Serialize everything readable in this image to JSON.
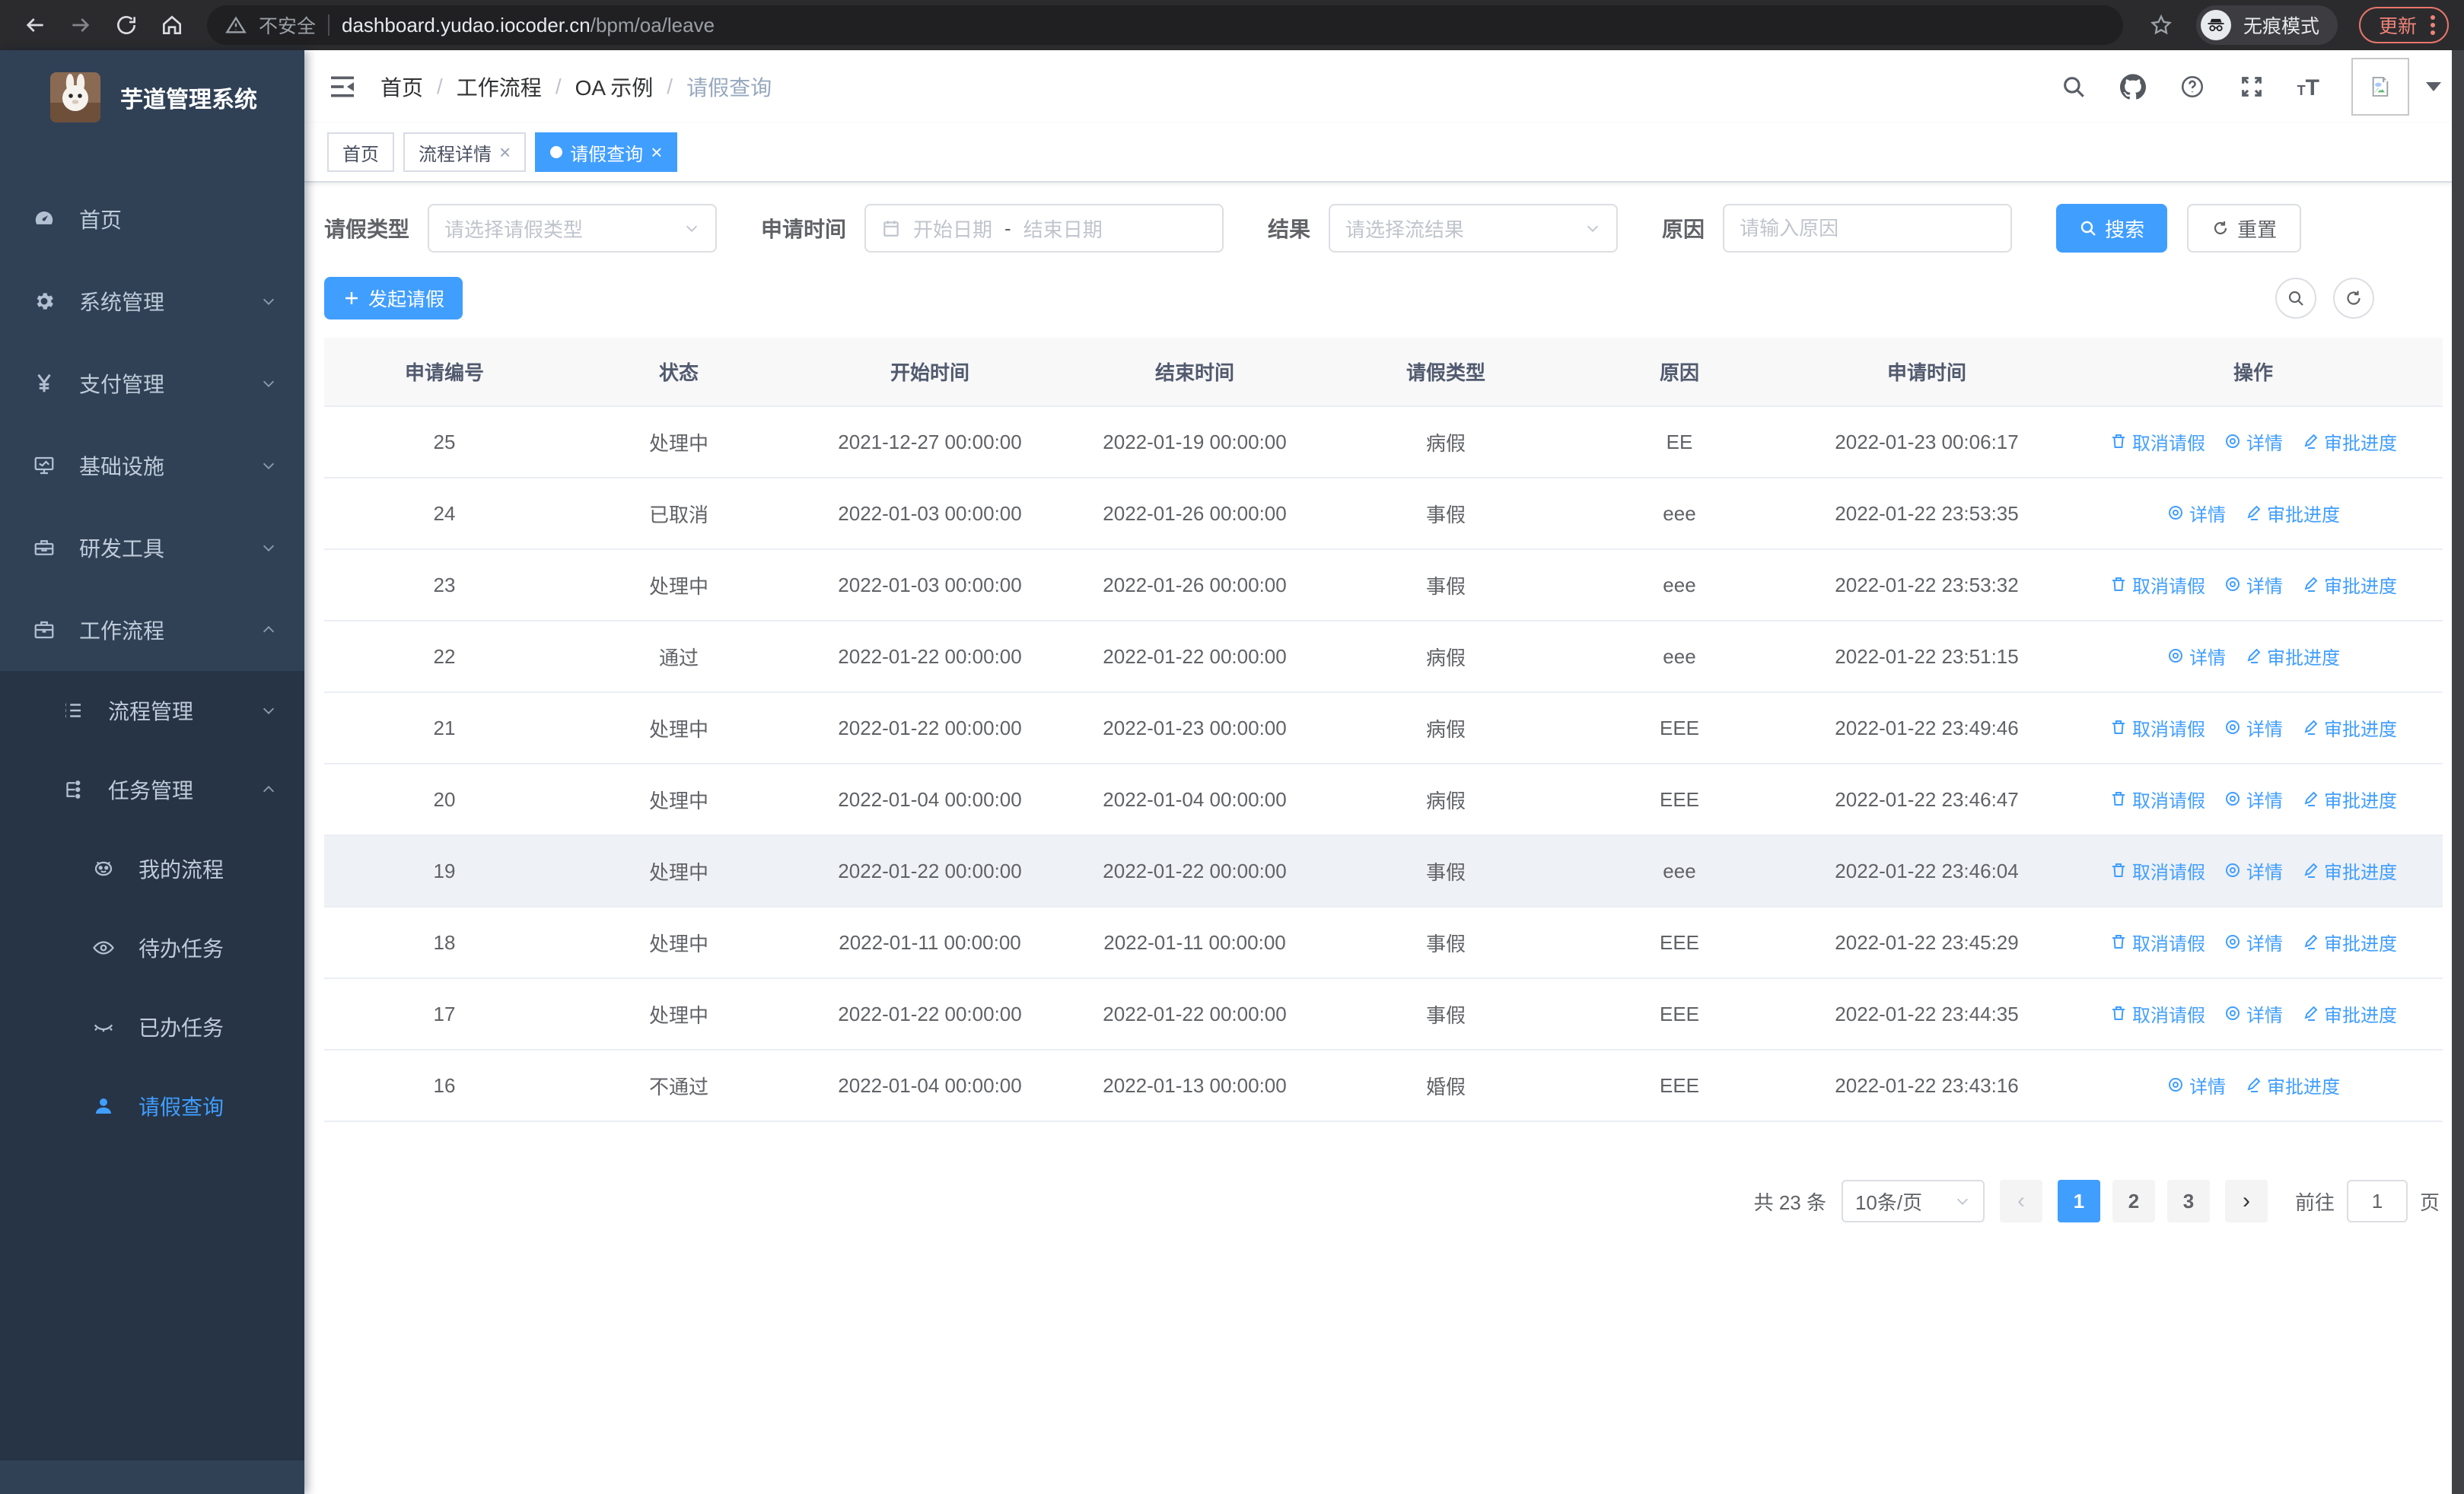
{
  "browser": {
    "security_label": "不安全",
    "url_host": "dashboard.yudao.iocoder.cn",
    "url_path": "/bpm/oa/leave",
    "incognito_label": "无痕模式",
    "update_label": "更新"
  },
  "sidebar": {
    "title": "芋道管理系统",
    "items": [
      {
        "label": "首页"
      },
      {
        "label": "系统管理"
      },
      {
        "label": "支付管理"
      },
      {
        "label": "基础设施"
      },
      {
        "label": "研发工具"
      },
      {
        "label": "工作流程"
      }
    ],
    "submenu": [
      {
        "label": "流程管理"
      },
      {
        "label": "任务管理"
      }
    ],
    "tasks": [
      {
        "label": "我的流程"
      },
      {
        "label": "待办任务"
      },
      {
        "label": "已办任务"
      },
      {
        "label": "请假查询"
      }
    ]
  },
  "header": {
    "breadcrumb": [
      "首页",
      "工作流程",
      "OA 示例",
      "请假查询"
    ]
  },
  "tabs": [
    {
      "label": "首页"
    },
    {
      "label": "流程详情"
    },
    {
      "label": "请假查询"
    }
  ],
  "filters": {
    "leave_type_label": "请假类型",
    "leave_type_placeholder": "请选择请假类型",
    "apply_time_label": "申请时间",
    "date_start_placeholder": "开始日期",
    "date_separator": "-",
    "date_end_placeholder": "结束日期",
    "result_label": "结果",
    "result_placeholder": "请选择流结果",
    "reason_label": "原因",
    "reason_placeholder": "请输入原因",
    "search_label": "搜索",
    "reset_label": "重置"
  },
  "toolbar": {
    "create_label": "发起请假"
  },
  "table": {
    "headers": [
      "申请编号",
      "状态",
      "开始时间",
      "结束时间",
      "请假类型",
      "原因",
      "申请时间",
      "操作"
    ],
    "action_labels": {
      "cancel": "取消请假",
      "detail": "详情",
      "progress": "审批进度"
    },
    "rows": [
      {
        "id": "25",
        "status": "处理中",
        "start": "2021-12-27 00:00:00",
        "end": "2022-01-19 00:00:00",
        "type": "病假",
        "reason": "EE",
        "applied": "2022-01-23 00:06:17",
        "actions": [
          "cancel",
          "detail",
          "progress"
        ]
      },
      {
        "id": "24",
        "status": "已取消",
        "start": "2022-01-03 00:00:00",
        "end": "2022-01-26 00:00:00",
        "type": "事假",
        "reason": "eee",
        "applied": "2022-01-22 23:53:35",
        "actions": [
          "detail",
          "progress"
        ]
      },
      {
        "id": "23",
        "status": "处理中",
        "start": "2022-01-03 00:00:00",
        "end": "2022-01-26 00:00:00",
        "type": "事假",
        "reason": "eee",
        "applied": "2022-01-22 23:53:32",
        "actions": [
          "cancel",
          "detail",
          "progress"
        ]
      },
      {
        "id": "22",
        "status": "通过",
        "start": "2022-01-22 00:00:00",
        "end": "2022-01-22 00:00:00",
        "type": "病假",
        "reason": "eee",
        "applied": "2022-01-22 23:51:15",
        "actions": [
          "detail",
          "progress"
        ]
      },
      {
        "id": "21",
        "status": "处理中",
        "start": "2022-01-22 00:00:00",
        "end": "2022-01-23 00:00:00",
        "type": "病假",
        "reason": "EEE",
        "applied": "2022-01-22 23:49:46",
        "actions": [
          "cancel",
          "detail",
          "progress"
        ]
      },
      {
        "id": "20",
        "status": "处理中",
        "start": "2022-01-04 00:00:00",
        "end": "2022-01-04 00:00:00",
        "type": "病假",
        "reason": "EEE",
        "applied": "2022-01-22 23:46:47",
        "actions": [
          "cancel",
          "detail",
          "progress"
        ]
      },
      {
        "id": "19",
        "status": "处理中",
        "start": "2022-01-22 00:00:00",
        "end": "2022-01-22 00:00:00",
        "type": "事假",
        "reason": "eee",
        "applied": "2022-01-22 23:46:04",
        "actions": [
          "cancel",
          "detail",
          "progress"
        ],
        "highlight": true
      },
      {
        "id": "18",
        "status": "处理中",
        "start": "2022-01-11 00:00:00",
        "end": "2022-01-11 00:00:00",
        "type": "事假",
        "reason": "EEE",
        "applied": "2022-01-22 23:45:29",
        "actions": [
          "cancel",
          "detail",
          "progress"
        ]
      },
      {
        "id": "17",
        "status": "处理中",
        "start": "2022-01-22 00:00:00",
        "end": "2022-01-22 00:00:00",
        "type": "事假",
        "reason": "EEE",
        "applied": "2022-01-22 23:44:35",
        "actions": [
          "cancel",
          "detail",
          "progress"
        ]
      },
      {
        "id": "16",
        "status": "不通过",
        "start": "2022-01-04 00:00:00",
        "end": "2022-01-13 00:00:00",
        "type": "婚假",
        "reason": "EEE",
        "applied": "2022-01-22 23:43:16",
        "actions": [
          "detail",
          "progress"
        ]
      }
    ]
  },
  "pagination": {
    "total": "共 23 条",
    "page_size": "10条/页",
    "pages": [
      "1",
      "2",
      "3"
    ],
    "active_page": "1",
    "goto_label": "前往",
    "goto_value": "1",
    "page_unit": "页"
  },
  "colors": {
    "primary": "#409eff",
    "sidebar_bg": "#304156",
    "submenu_bg": "#263445"
  }
}
